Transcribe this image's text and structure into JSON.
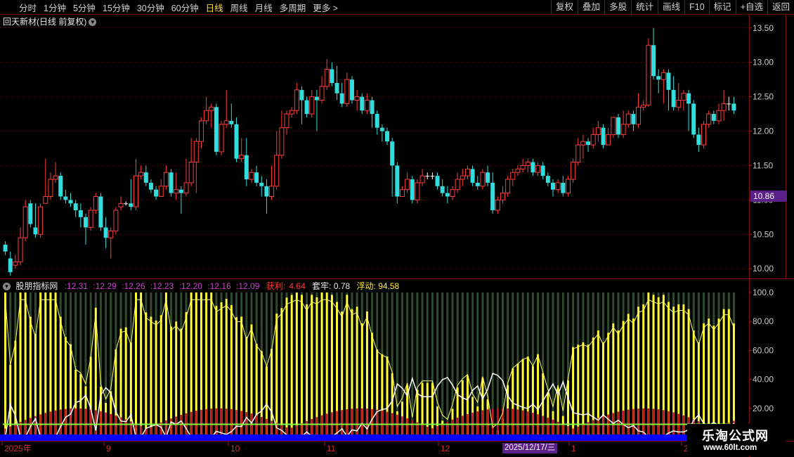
{
  "toolbar": {
    "periods": [
      "分时",
      "1分钟",
      "5分钟",
      "15分钟",
      "30分钟",
      "60分钟",
      "日线",
      "周线",
      "月线",
      "多周期",
      "更多 >"
    ],
    "active_period": "日线",
    "right_buttons": [
      "复权",
      "叠加",
      "多股",
      "统计",
      "画线",
      "F10",
      "标记",
      "+自选",
      "返回"
    ]
  },
  "main": {
    "title": "回天新材(日线 前复权)",
    "price_axis": [
      "13.50",
      "13.00",
      "12.50",
      "12.00",
      "11.50",
      "11.00",
      "10.50",
      "10.00"
    ],
    "current_price": "10.86"
  },
  "indicator": {
    "name": "股朋指标网",
    "values": [
      ":12.31",
      ":12.29",
      ":12.26",
      ":12.23",
      ":12.20",
      ":12.16",
      ":12.09"
    ],
    "profit_label": "获利:",
    "profit_value": "4.64",
    "trap_label": "套牢:",
    "trap_value": "0.78",
    "float_label": "浮动:",
    "float_value": "94.58",
    "axis": [
      "100.0",
      "80.00",
      "60.00",
      "40.00",
      "20.00"
    ]
  },
  "time_axis": {
    "labels": [
      "2025年",
      "9",
      "10",
      "11",
      "12",
      "1",
      "2"
    ],
    "cursor_date": "2025/12/17/三"
  },
  "watermark": {
    "line1": "乐淘公式网",
    "line2": "www.60lt.com"
  },
  "colors": {
    "up": "#ff3b3b",
    "down": "#33dddd",
    "profit_bar": "#ffff33",
    "trap_bar": "#2f4a2f",
    "red_area": "#cc1122",
    "cost_line": "#ffffff",
    "blue_base": "#0000ff"
  },
  "chart_data": {
    "type": "candlestick",
    "price_range": [
      9.9,
      13.6
    ],
    "candles": [
      [
        10.35,
        10.25,
        10.4,
        10.2
      ],
      [
        10.15,
        9.95,
        10.25,
        9.9
      ],
      [
        10.05,
        10.1,
        10.2,
        10
      ],
      [
        10.1,
        10.45,
        10.6,
        10.05
      ],
      [
        10.45,
        10.9,
        11,
        10.4
      ],
      [
        10.95,
        10.65,
        11,
        10.6
      ],
      [
        10.6,
        10.5,
        10.95,
        10.45
      ],
      [
        10.5,
        10.9,
        10.95,
        10.45
      ],
      [
        10.95,
        11.05,
        11.6,
        10.95
      ],
      [
        11.05,
        11.3,
        11.4,
        11
      ],
      [
        11.3,
        11.35,
        11.55,
        11.25
      ],
      [
        11.35,
        11.05,
        11.4,
        11
      ],
      [
        11.05,
        11,
        11.15,
        10.95
      ],
      [
        11,
        10.95,
        11.1,
        10.9
      ],
      [
        10.95,
        10.85,
        11,
        10.75
      ],
      [
        10.85,
        10.75,
        10.95,
        10.6
      ],
      [
        10.75,
        10.6,
        10.8,
        10.35
      ],
      [
        10.6,
        10.85,
        10.9,
        10.55
      ],
      [
        10.85,
        11.05,
        11.1,
        10.8
      ],
      [
        11.05,
        10.6,
        11.1,
        10.55
      ],
      [
        10.6,
        10.45,
        10.75,
        10.3
      ],
      [
        10.45,
        10.55,
        10.6,
        10.15
      ],
      [
        10.55,
        10.85,
        10.9,
        10.5
      ],
      [
        10.9,
        10.95,
        11.05,
        10.85
      ],
      [
        10.95,
        10.95,
        10.98,
        10.92
      ],
      [
        10.95,
        10.9,
        11.3,
        10.85
      ],
      [
        10.9,
        11.35,
        11.6,
        10.85
      ],
      [
        11.35,
        11.4,
        11.5,
        11.3
      ],
      [
        11.4,
        11.25,
        11.5,
        11.2
      ],
      [
        11.25,
        11.15,
        11.3,
        11.1
      ],
      [
        11.15,
        11.05,
        11.2,
        11
      ],
      [
        11.05,
        11.2,
        11.3,
        11.05
      ],
      [
        11.2,
        11.4,
        11.5,
        11.15
      ],
      [
        11.4,
        11.1,
        11.45,
        11.05
      ],
      [
        11.1,
        11.15,
        11.4,
        11
      ],
      [
        11.15,
        11.1,
        11.2,
        10.8
      ],
      [
        11.1,
        11.25,
        11.6,
        11.05
      ],
      [
        11.25,
        11.55,
        11.9,
        11.2
      ],
      [
        11.55,
        11.85,
        11.9,
        11.1
      ],
      [
        11.85,
        12.15,
        12.2,
        11.75
      ],
      [
        12.15,
        12.3,
        12.5,
        12.1
      ],
      [
        12.3,
        12.35,
        12.4,
        12.05
      ],
      [
        12.35,
        11.7,
        12.4,
        11.65
      ],
      [
        11.7,
        12.1,
        12.15,
        11.65
      ],
      [
        12.1,
        12.15,
        12.6,
        12.05
      ],
      [
        12.15,
        12.1,
        12.4,
        12.05
      ],
      [
        12.1,
        11.6,
        12.2,
        11.55
      ],
      [
        11.6,
        11.65,
        11.9,
        11.55
      ],
      [
        11.65,
        11.3,
        11.9,
        11.2
      ],
      [
        11.3,
        11.4,
        11.45,
        11.25
      ],
      [
        11.4,
        11.25,
        11.5,
        11.2
      ],
      [
        11.25,
        11.2,
        11.35,
        11.05
      ],
      [
        11.2,
        11.05,
        11.3,
        10.8
      ],
      [
        11.05,
        11.2,
        11.5,
        11
      ],
      [
        11.2,
        11.65,
        12,
        11.15
      ],
      [
        11.65,
        12.05,
        12.3,
        11.6
      ],
      [
        12.05,
        12.25,
        12.3,
        11.95
      ],
      [
        12.25,
        12.3,
        12.35,
        12.2
      ],
      [
        12.3,
        12.6,
        12.7,
        12.25
      ],
      [
        12.6,
        12.45,
        12.65,
        12.1
      ],
      [
        12.45,
        12.25,
        12.5,
        12.2
      ],
      [
        12.25,
        12.5,
        12.6,
        12.2
      ],
      [
        12.5,
        12.45,
        12.6,
        12
      ],
      [
        12.45,
        12.65,
        12.8,
        12.4
      ],
      [
        12.65,
        12.9,
        13.05,
        12.6
      ],
      [
        12.9,
        12.7,
        13,
        12.65
      ],
      [
        12.7,
        12.55,
        12.95,
        12.45
      ],
      [
        12.55,
        12.4,
        12.7,
        12.35
      ],
      [
        12.4,
        12.75,
        12.85,
        12.35
      ],
      [
        12.75,
        12.45,
        12.8,
        12.4
      ],
      [
        12.45,
        12.5,
        12.6,
        12.3
      ],
      [
        12.5,
        12.3,
        12.55,
        12.25
      ],
      [
        12.3,
        12.45,
        12.55,
        12.25
      ],
      [
        12.45,
        12.25,
        12.5,
        12.05
      ],
      [
        12.25,
        12.05,
        12.3,
        11.95
      ],
      [
        12.05,
        12,
        12.1,
        11.85
      ],
      [
        12,
        11.85,
        12.05,
        11.8
      ],
      [
        11.85,
        11.5,
        11.9,
        11.05
      ],
      [
        11.5,
        11.05,
        11.55,
        10.95
      ],
      [
        11.05,
        11.15,
        11.2,
        11.05
      ],
      [
        11.15,
        11.3,
        11.4,
        11.1
      ],
      [
        11.3,
        11,
        11.35,
        10.95
      ],
      [
        11,
        11.25,
        11.3,
        10.95
      ],
      [
        11.25,
        11.35,
        11.45,
        11.2
      ],
      [
        11.35,
        11.35,
        11.4,
        11.3
      ],
      [
        11.35,
        11.35,
        11.4,
        11.3
      ],
      [
        11.35,
        11.2,
        11.4,
        11.15
      ],
      [
        11.2,
        11.1,
        11.3,
        11.05
      ],
      [
        11.1,
        11.05,
        11.2,
        10.95
      ],
      [
        11.05,
        11.15,
        11.2,
        11
      ],
      [
        11.15,
        11.3,
        11.4,
        11.1
      ],
      [
        11.3,
        11.35,
        11.45,
        11.2
      ],
      [
        11.35,
        11.45,
        11.5,
        11.3
      ],
      [
        11.45,
        11.25,
        11.5,
        11.2
      ],
      [
        11.25,
        11.2,
        11.35,
        11.15
      ],
      [
        11.2,
        11.4,
        11.45,
        11.15
      ],
      [
        11.4,
        11.25,
        11.5,
        11.2
      ],
      [
        11.25,
        10.85,
        11.4,
        10.8
      ],
      [
        10.85,
        11,
        11.05,
        10.8
      ],
      [
        11,
        11.1,
        11.2,
        10.95
      ],
      [
        11.1,
        11.3,
        11.35,
        11.05
      ],
      [
        11.3,
        11.4,
        11.45,
        11.2
      ],
      [
        11.4,
        11.45,
        11.5,
        11.35
      ],
      [
        11.45,
        11.5,
        11.6,
        11.4
      ],
      [
        11.5,
        11.55,
        11.6,
        11.4
      ],
      [
        11.55,
        11.4,
        11.6,
        11.35
      ],
      [
        11.4,
        11.5,
        11.55,
        11.35
      ],
      [
        11.5,
        11.35,
        11.55,
        11.3
      ],
      [
        11.35,
        11.25,
        11.4,
        11.2
      ],
      [
        11.25,
        11.15,
        11.3,
        11.05
      ],
      [
        11.15,
        11.25,
        11.3,
        11.1
      ],
      [
        11.25,
        11.1,
        11.35,
        11.05
      ],
      [
        11.1,
        11.3,
        11.35,
        11.05
      ],
      [
        11.3,
        11.55,
        11.6,
        11.25
      ],
      [
        11.55,
        11.8,
        11.9,
        11.5
      ],
      [
        11.8,
        11.85,
        11.95,
        11.6
      ],
      [
        11.85,
        11.8,
        11.9,
        11.7
      ],
      [
        11.8,
        11.95,
        12.05,
        11.75
      ],
      [
        11.95,
        12.05,
        12.15,
        11.85
      ],
      [
        12.05,
        11.8,
        12.1,
        11.75
      ],
      [
        11.8,
        11.95,
        12.05,
        11.8
      ],
      [
        11.95,
        12.2,
        12.2,
        11.9
      ],
      [
        12.2,
        11.95,
        12.25,
        11.9
      ],
      [
        11.95,
        12.1,
        12.3,
        11.9
      ],
      [
        12.1,
        12.25,
        12.3,
        12.05
      ],
      [
        12.25,
        12.1,
        12.3,
        12
      ],
      [
        12.1,
        12.35,
        12.55,
        12.05
      ],
      [
        12.35,
        12.38,
        12.45,
        12.3
      ],
      [
        12.38,
        13.25,
        13.35,
        12.35
      ],
      [
        13.25,
        12.8,
        13.5,
        12.75
      ],
      [
        12.8,
        12.75,
        12.9,
        12.55
      ],
      [
        12.75,
        12.85,
        12.9,
        12.4
      ],
      [
        12.85,
        12.6,
        12.9,
        12.3
      ],
      [
        12.6,
        12.35,
        12.8,
        12.3
      ],
      [
        12.35,
        12.45,
        12.7,
        12.3
      ],
      [
        12.45,
        12.55,
        12.6,
        12.3
      ],
      [
        12.55,
        12.4,
        12.6,
        12
      ],
      [
        12.4,
        11.95,
        12.45,
        11.9
      ],
      [
        11.95,
        11.8,
        12.05,
        11.7
      ],
      [
        11.8,
        12.1,
        12.15,
        11.75
      ],
      [
        12.1,
        12.25,
        12.3,
        12.05
      ],
      [
        12.25,
        12.15,
        12.3,
        12.1
      ],
      [
        12.15,
        12.3,
        12.4,
        12.1
      ],
      [
        12.3,
        12.4,
        12.6,
        12.15
      ],
      [
        12.4,
        12.4,
        12.5,
        12.3
      ],
      [
        12.4,
        12.3,
        12.5,
        12.25
      ]
    ],
    "indicator_range": [
      0,
      100
    ],
    "profit_series": "yellow bars 0-100",
    "float_value": 94.58
  }
}
